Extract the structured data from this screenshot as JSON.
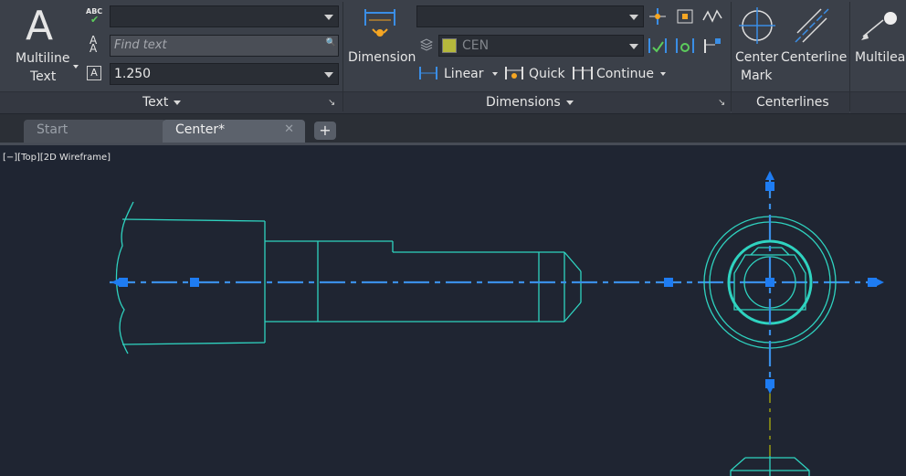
{
  "ribbon": {
    "text_panel": {
      "multiline_text_label_1": "Multiline",
      "multiline_text_label_2": "Text",
      "text_style_value": "",
      "find_text_placeholder": "Find text",
      "text_height_value": "1.250",
      "footer_label": "Text"
    },
    "dimensions_panel": {
      "dimension_label": "Dimension",
      "dim_style_value": "",
      "layer_value": "CEN",
      "layer_color": "#b5b83c",
      "linear_label": "Linear",
      "quick_label": "Quick",
      "continue_label": "Continue",
      "footer_label": "Dimensions"
    },
    "centerlines_panel": {
      "center_mark_label_1": "Center",
      "center_mark_label_2": "Mark",
      "centerline_label": "Centerline",
      "footer_label": "Centerlines"
    },
    "leaders_panel": {
      "multileader_label": "Multilead"
    }
  },
  "tabs": [
    {
      "label": "Start",
      "active": false
    },
    {
      "label": "Center*",
      "active": true
    }
  ],
  "viewport": {
    "label": "[−][Top][2D Wireframe]",
    "drawing_color": "#2fd3c0",
    "centerline_color": "#3a8ee6",
    "grip_color": "#1e7cf2",
    "hidden_line_color": "#d6d600"
  }
}
